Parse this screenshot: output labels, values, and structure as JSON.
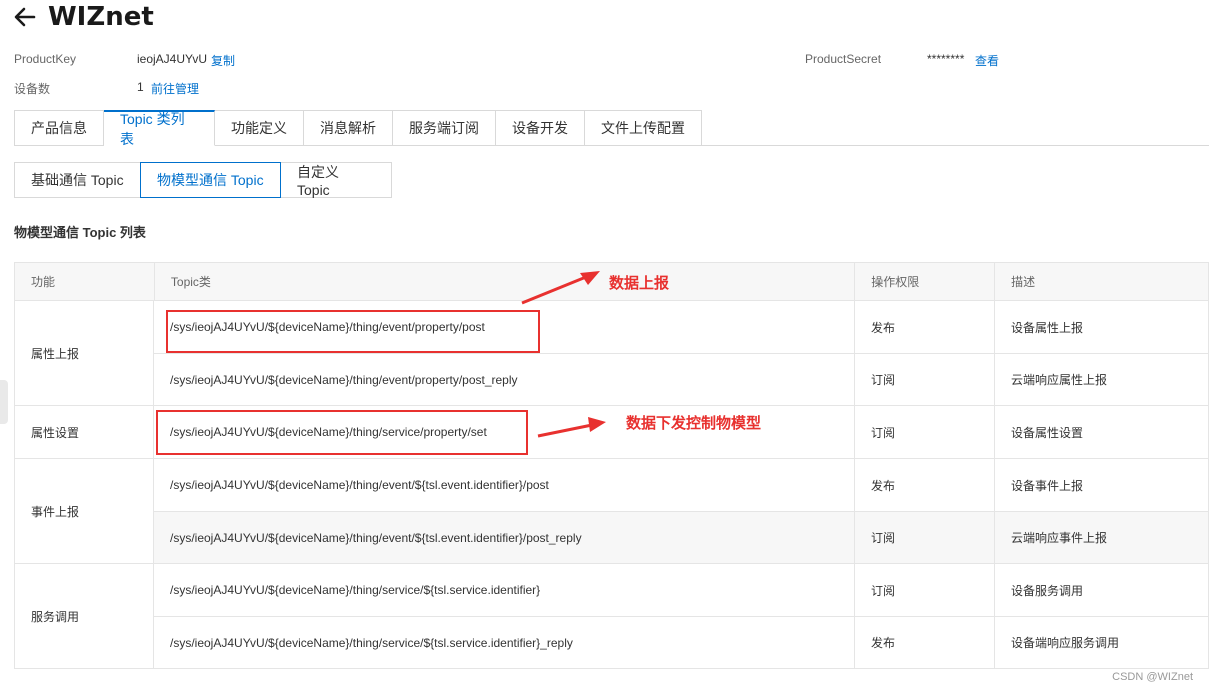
{
  "header": {
    "title": "WIZnet"
  },
  "meta": {
    "product_key_label": "ProductKey",
    "product_key_value": "ieojAJ4UYvU",
    "copy_link": "复制",
    "device_count_label": "设备数",
    "device_count_value": "1",
    "manage_link": "前往管理",
    "product_secret_label": "ProductSecret",
    "product_secret_value": "********",
    "view_link": "查看"
  },
  "tabs": [
    {
      "label": "产品信息"
    },
    {
      "label": "Topic 类列表"
    },
    {
      "label": "功能定义"
    },
    {
      "label": "消息解析"
    },
    {
      "label": "服务端订阅"
    },
    {
      "label": "设备开发"
    },
    {
      "label": "文件上传配置"
    }
  ],
  "subtabs": [
    {
      "label": "基础通信 Topic"
    },
    {
      "label": "物模型通信 Topic"
    },
    {
      "label": "自定义 Topic"
    }
  ],
  "section_title": "物模型通信 Topic 列表",
  "table": {
    "headers": [
      "功能",
      "Topic类",
      "操作权限",
      "描述"
    ],
    "groups": [
      {
        "name": "属性上报",
        "rows": [
          {
            "topic": "/sys/ieojAJ4UYvU/${deviceName}/thing/event/property/post",
            "perm": "发布",
            "desc": "设备属性上报"
          },
          {
            "topic": "/sys/ieojAJ4UYvU/${deviceName}/thing/event/property/post_reply",
            "perm": "订阅",
            "desc": "云端响应属性上报"
          }
        ]
      },
      {
        "name": "属性设置",
        "rows": [
          {
            "topic": "/sys/ieojAJ4UYvU/${deviceName}/thing/service/property/set",
            "perm": "订阅",
            "desc": "设备属性设置"
          }
        ]
      },
      {
        "name": "事件上报",
        "rows": [
          {
            "topic": "/sys/ieojAJ4UYvU/${deviceName}/thing/event/${tsl.event.identifier}/post",
            "perm": "发布",
            "desc": "设备事件上报"
          },
          {
            "topic": "/sys/ieojAJ4UYvU/${deviceName}/thing/event/${tsl.event.identifier}/post_reply",
            "perm": "订阅",
            "desc": "云端响应事件上报"
          }
        ]
      },
      {
        "name": "服务调用",
        "rows": [
          {
            "topic": "/sys/ieojAJ4UYvU/${deviceName}/thing/service/${tsl.service.identifier}",
            "perm": "订阅",
            "desc": "设备服务调用"
          },
          {
            "topic": "/sys/ieojAJ4UYvU/${deviceName}/thing/service/${tsl.service.identifier}_reply",
            "perm": "发布",
            "desc": "设备端响应服务调用"
          }
        ]
      }
    ]
  },
  "annotations": {
    "upload": "数据上报",
    "downlink": "数据下发控制物模型"
  },
  "watermark": "CSDN @WIZnet",
  "colors": {
    "accent": "#0070cc",
    "annotation": "#e8312f"
  }
}
